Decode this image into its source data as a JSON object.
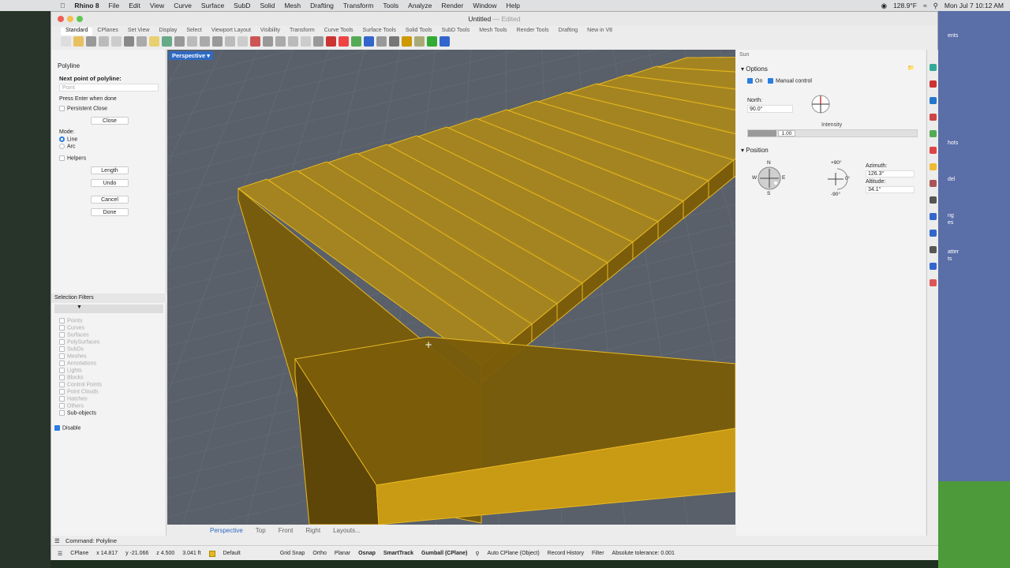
{
  "menubar": {
    "app": "Rhino 8",
    "items": [
      "File",
      "Edit",
      "View",
      "Curve",
      "Surface",
      "SubD",
      "Solid",
      "Mesh",
      "Drafting",
      "Transform",
      "Tools",
      "Analyze",
      "Render",
      "Window",
      "Help"
    ],
    "temp": "128.9°F",
    "clock": "Mon Jul 7  10:12 AM"
  },
  "window": {
    "title": "Untitled",
    "edited": "— Edited",
    "tabs": [
      "Standard",
      "CPlanes",
      "Set View",
      "Display",
      "Select",
      "Viewport Layout",
      "Visibility",
      "Transform",
      "Curve Tools",
      "Surface Tools",
      "Solid Tools",
      "SubD Tools",
      "Mesh Tools",
      "Render Tools",
      "Drafting",
      "New in V8"
    ],
    "active_tab": "Standard"
  },
  "command_panel": {
    "title": "Polyline",
    "prompt": "Next point of polyline:",
    "point_placeholder": "Point",
    "hint": "Press Enter when done",
    "persistent_close": "Persistent Close",
    "close_btn": "Close",
    "mode_label": "Mode:",
    "mode_line": "Line",
    "mode_arc": "Arc",
    "helpers": "Helpers",
    "length_btn": "Length",
    "undo_btn": "Undo",
    "cancel_btn": "Cancel",
    "done_btn": "Done"
  },
  "selection_filters": {
    "title": "Selection Filters",
    "items": [
      "Points",
      "Curves",
      "Surfaces",
      "PolySurfaces",
      "SubDs",
      "Meshes",
      "Annotations",
      "Lights",
      "Blocks",
      "Control Points",
      "Point Clouds",
      "Hatches",
      "Others"
    ],
    "sub_objects": "Sub-objects",
    "disable": "Disable"
  },
  "viewport": {
    "name": "Perspective",
    "tabs": [
      "Perspective",
      "Top",
      "Front",
      "Right",
      "Layouts..."
    ]
  },
  "sun": {
    "title": "Sun",
    "options": "Options",
    "on": "On",
    "manual": "Manual control",
    "north_label": "North:",
    "north_value": "90.0°",
    "intensity_label": "Intensity",
    "intensity_value": "1.00",
    "position": "Position",
    "compass_n": "N",
    "compass_s": "S",
    "compass_e": "E",
    "compass_w": "W",
    "alt_top": "+90°",
    "alt_bottom": "-90°",
    "alt_right": "0°",
    "azimuth_label": "Azimuth:",
    "azimuth_value": "126.3°",
    "altitude_label": "Altitude:",
    "altitude_value": "34.1°"
  },
  "command_line": "Command: Polyline",
  "status": {
    "cplane": "CPlane",
    "x": "x 14.817",
    "y": "y -21.066",
    "z": "z 4.500",
    "dist": "3.041 ft",
    "layer": "Default",
    "items": [
      "Grid Snap",
      "Ortho",
      "Planar",
      "Osnap",
      "SmartTrack",
      "Gumball (CPlane)",
      "Auto CPlane (Object)",
      "Record History",
      "Filter"
    ],
    "tolerance": "Absolute tolerance: 0.001"
  },
  "desktop_labels": [
    "ents",
    "hots",
    "del",
    "ng",
    "es",
    "atter",
    "ts"
  ],
  "colors": {
    "stair_fill": "#7a5c0a",
    "stair_edge": "#e8b820",
    "viewport_bg": "#59606a",
    "accent": "#2a7de1"
  }
}
